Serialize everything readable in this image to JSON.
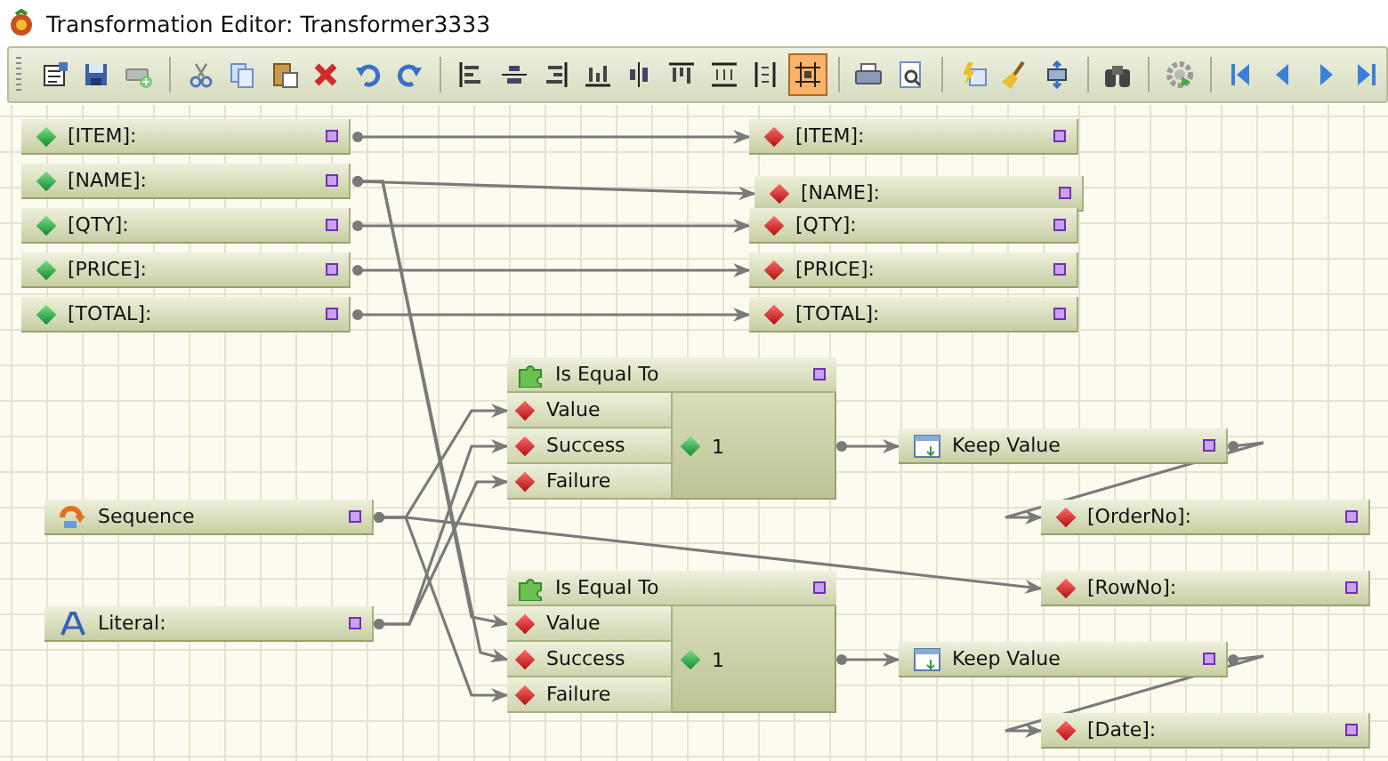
{
  "window": {
    "title": "Transformation Editor: Transformer3333"
  },
  "toolbar_groups": [
    [
      {
        "kind": "properties",
        "selected": false
      },
      {
        "kind": "save",
        "selected": false
      },
      {
        "kind": "add",
        "selected": false
      }
    ],
    [
      {
        "kind": "cut",
        "selected": false
      },
      {
        "kind": "copy",
        "selected": false
      },
      {
        "kind": "paste",
        "selected": false
      },
      {
        "kind": "delete",
        "selected": false
      },
      {
        "kind": "undo",
        "selected": false
      },
      {
        "kind": "redo",
        "selected": false
      }
    ],
    [
      {
        "kind": "align-left",
        "selected": false
      },
      {
        "kind": "align-center",
        "selected": false
      },
      {
        "kind": "align-right",
        "selected": false
      },
      {
        "kind": "align-bottom",
        "selected": false
      },
      {
        "kind": "align-middle",
        "selected": false
      },
      {
        "kind": "align-top",
        "selected": false
      },
      {
        "kind": "same-width",
        "selected": false
      },
      {
        "kind": "same-height",
        "selected": false
      },
      {
        "kind": "fit",
        "selected": true
      }
    ],
    [
      {
        "kind": "print",
        "selected": false
      },
      {
        "kind": "preview",
        "selected": false
      }
    ],
    [
      {
        "kind": "wizard",
        "selected": false
      },
      {
        "kind": "broom",
        "selected": false
      },
      {
        "kind": "convert",
        "selected": false
      }
    ],
    [
      {
        "kind": "find",
        "selected": false
      }
    ],
    [
      {
        "kind": "run",
        "selected": false
      }
    ],
    [
      {
        "kind": "first",
        "selected": false
      },
      {
        "kind": "prev",
        "selected": false
      },
      {
        "kind": "next",
        "selected": false
      },
      {
        "kind": "last",
        "selected": false
      }
    ]
  ],
  "sources": [
    {
      "label": "[ITEM]:"
    },
    {
      "label": "[NAME]:"
    },
    {
      "label": "[QTY]:"
    },
    {
      "label": "[PRICE]:"
    },
    {
      "label": "[TOTAL]:"
    }
  ],
  "targets": [
    {
      "label": "[ITEM]:"
    },
    {
      "label": "[NAME]:"
    },
    {
      "label": "[QTY]:"
    },
    {
      "label": "[PRICE]:"
    },
    {
      "label": "[TOTAL]:"
    },
    {
      "label": "[OrderNo]:"
    },
    {
      "label": "[RowNo]:"
    },
    {
      "label": "[Date]:"
    }
  ],
  "functions": [
    {
      "kind": "sequence",
      "label": "Sequence"
    },
    {
      "kind": "literal",
      "label": "Literal:"
    }
  ],
  "comparisons": [
    {
      "title": "Is Equal To",
      "inputs": [
        "Value",
        "Success",
        "Failure"
      ],
      "output": "1"
    },
    {
      "title": "Is Equal To",
      "inputs": [
        "Value",
        "Success",
        "Failure"
      ],
      "output": "1"
    }
  ],
  "keep_values": [
    {
      "label": "Keep Value"
    },
    {
      "label": "Keep Value"
    }
  ]
}
